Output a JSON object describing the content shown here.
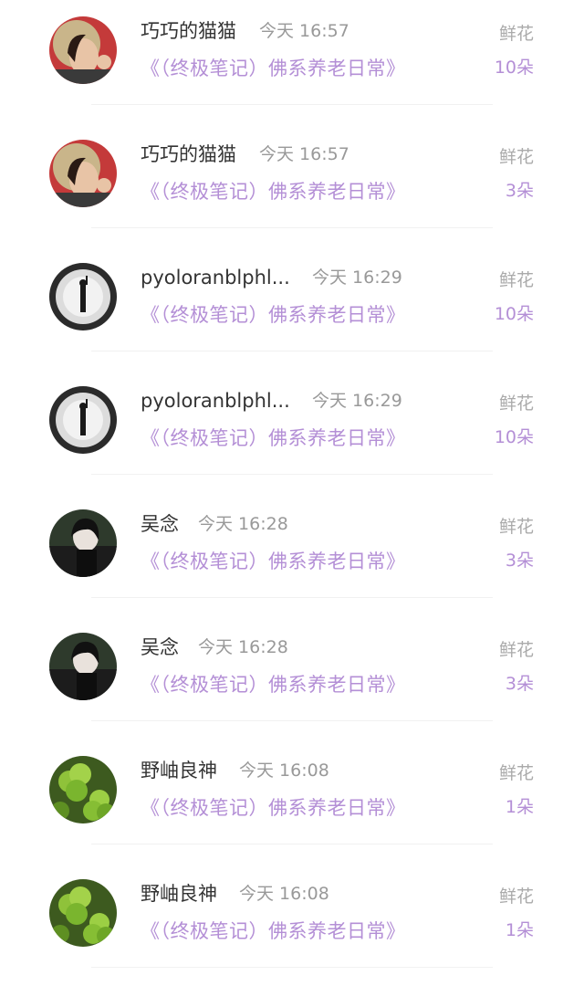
{
  "rows": [
    {
      "user": "巧巧的猫猫",
      "time": "今天 16:57",
      "book": "《（终极笔记）佛系养老日常》",
      "gift_label": "鲜花",
      "count": "10朵",
      "avatar": "portrait-woman-hat"
    },
    {
      "user": "巧巧的猫猫",
      "time": "今天 16:57",
      "book": "《（终极笔记）佛系养老日常》",
      "gift_label": "鲜花",
      "count": "3朵",
      "avatar": "portrait-woman-hat"
    },
    {
      "user": "pyoloranblphl...",
      "time": "今天 16:29",
      "book": "《（终极笔记）佛系养老日常》",
      "gift_label": "鲜花",
      "count": "10朵",
      "avatar": "silhouette-figure"
    },
    {
      "user": "pyoloranblphl...",
      "time": "今天 16:29",
      "book": "《（终极笔记）佛系养老日常》",
      "gift_label": "鲜花",
      "count": "10朵",
      "avatar": "silhouette-figure"
    },
    {
      "user": "吴念",
      "time": "今天 16:28",
      "book": "《（终极笔记）佛系养老日常》",
      "gift_label": "鲜花",
      "count": "3朵",
      "avatar": "anime-character"
    },
    {
      "user": "吴念",
      "time": "今天 16:28",
      "book": "《（终极笔记）佛系养老日常》",
      "gift_label": "鲜花",
      "count": "3朵",
      "avatar": "anime-character"
    },
    {
      "user": "野岫良神",
      "time": "今天 16:08",
      "book": "《（终极笔记）佛系养老日常》",
      "gift_label": "鲜花",
      "count": "1朵",
      "avatar": "clover-leaves"
    },
    {
      "user": "野岫良神",
      "time": "今天 16:08",
      "book": "《（终极笔记）佛系养老日常》",
      "gift_label": "鲜花",
      "count": "1朵",
      "avatar": "clover-leaves"
    }
  ],
  "colors": {
    "accent": "#b48fd6",
    "name": "#333333",
    "muted": "#999999"
  }
}
